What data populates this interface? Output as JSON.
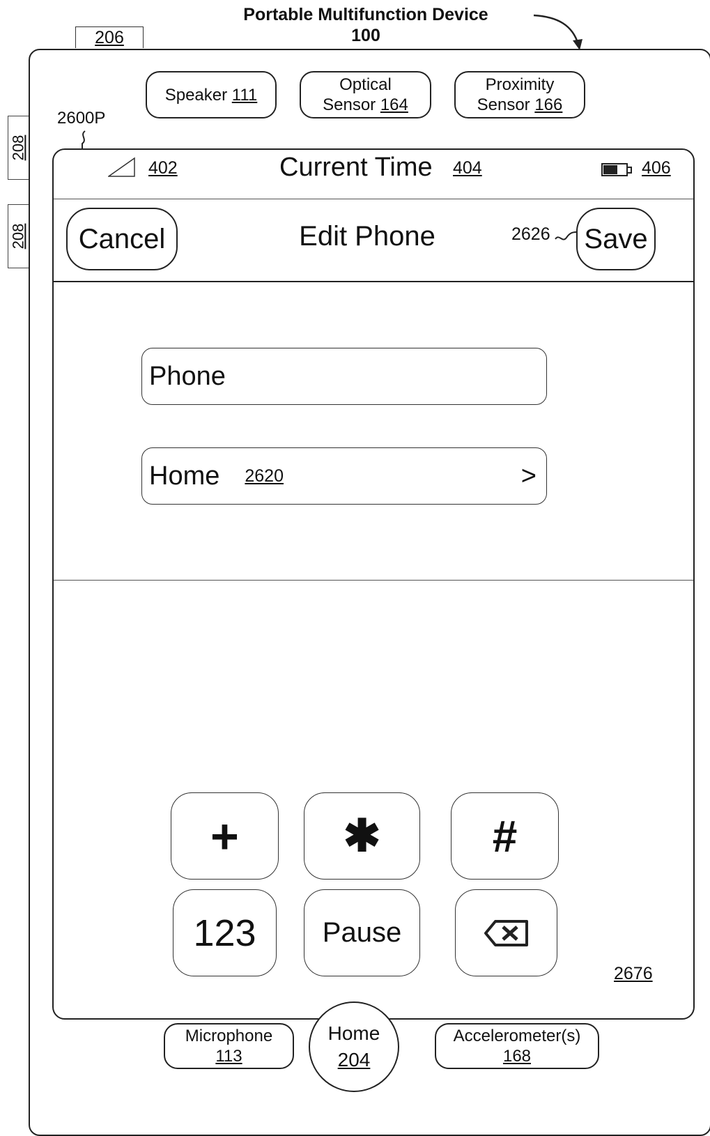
{
  "device": {
    "title": "Portable Multifunction Device",
    "ref": "100"
  },
  "refs": {
    "top_button": "206",
    "side_button_1": "208",
    "side_button_2": "208",
    "screen": "2600P",
    "keypad": "2676",
    "save": "2626"
  },
  "hardware_top": {
    "speaker": {
      "label": "Speaker",
      "ref": "111"
    },
    "optical": {
      "line1": "Optical",
      "line2": "Sensor",
      "ref": "164"
    },
    "proximity": {
      "line1": "Proximity",
      "line2": "Sensor",
      "ref": "166"
    }
  },
  "hardware_bottom": {
    "microphone": {
      "label": "Microphone",
      "ref": "113"
    },
    "home": {
      "label": "Home",
      "ref": "204"
    },
    "accelerometer": {
      "label": "Accelerometer(s)",
      "ref": "168"
    }
  },
  "statusbar": {
    "signal_ref": "402",
    "time_label": "Current Time",
    "time_ref": "404",
    "battery_ref": "406"
  },
  "navbar": {
    "cancel": "Cancel",
    "title": "Edit Phone",
    "save": "Save"
  },
  "form": {
    "phone_value": "Phone",
    "label_value": "Home",
    "label_ref": "2620",
    "chevron": ">"
  },
  "keypad": {
    "row1": [
      "+",
      "✱",
      "#"
    ],
    "row2": [
      "123",
      "Pause",
      "⌫"
    ]
  }
}
